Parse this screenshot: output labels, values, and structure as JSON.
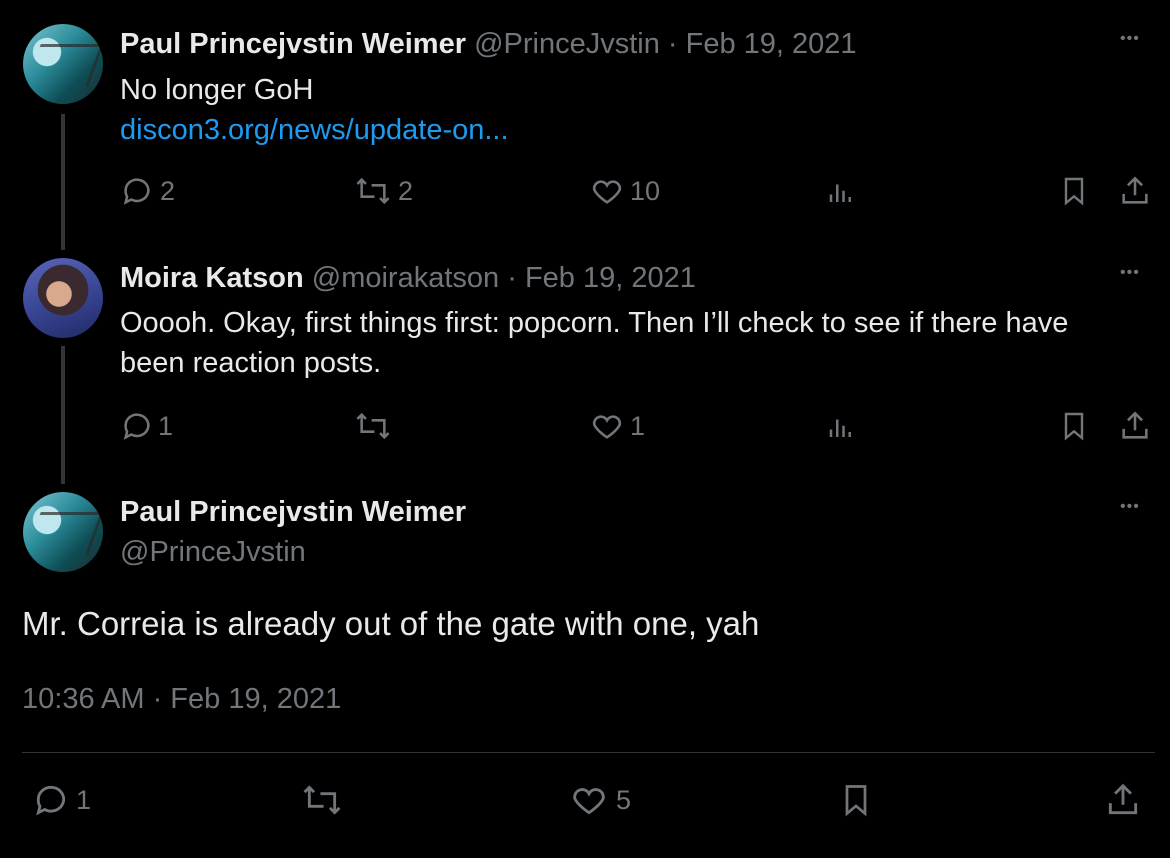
{
  "tweets": [
    {
      "name": "Paul Princejvstin Weimer",
      "handle": "@PrinceJvstin",
      "sep": " · ",
      "date": "Feb 19, 2021",
      "text": "No longer GoH",
      "link": "discon3.org/news/update-on...",
      "replies": "2",
      "retweets": "2",
      "likes": "10"
    },
    {
      "name": "Moira Katson",
      "handle": "@moirakatson",
      "sep": " · ",
      "date": "Feb 19, 2021",
      "text_line1": "Ooooh. Okay, first things first: popcorn. Then I’ll check to see if there have",
      "text_line2": "been reaction posts.",
      "replies": "1",
      "retweets": "",
      "likes": "1"
    }
  ],
  "main_tweet": {
    "name": "Paul Princejvstin Weimer",
    "handle": "@PrinceJvstin",
    "text": "Mr. Correia is already out of the gate with one, yah",
    "timestamp": "10:36 AM · Feb 19, 2021",
    "replies": "1",
    "retweets": "",
    "likes": "5"
  },
  "more_glyph": "•••",
  "colors": {
    "background": "#000000",
    "text": "#e7e9ea",
    "muted": "#71767b",
    "link": "#1d9bf0"
  }
}
